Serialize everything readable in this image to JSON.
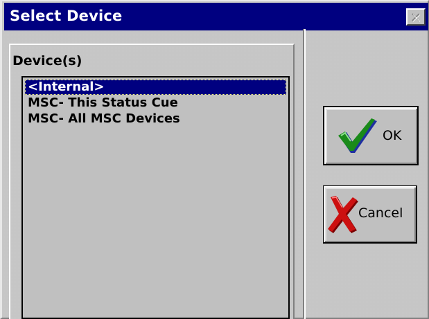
{
  "window": {
    "title": "Select Device"
  },
  "devices": {
    "label": "Device(s)",
    "items": [
      {
        "label": "<Internal>",
        "selected": true
      },
      {
        "label": "MSC- This Status Cue",
        "selected": false
      },
      {
        "label": "MSC- All MSC Devices",
        "selected": false
      }
    ]
  },
  "buttons": {
    "ok_label": "OK",
    "cancel_label": "Cancel"
  },
  "icons": {
    "close": "close-icon",
    "ok": "checkmark-icon",
    "cancel": "red-x-icon"
  },
  "colors": {
    "titlebar": "#000080",
    "face": "#c0c0c0",
    "selection": "#000080",
    "check_green": "#1a8a1a",
    "check_blue": "#1f2fa0",
    "x_red": "#cc1010"
  }
}
